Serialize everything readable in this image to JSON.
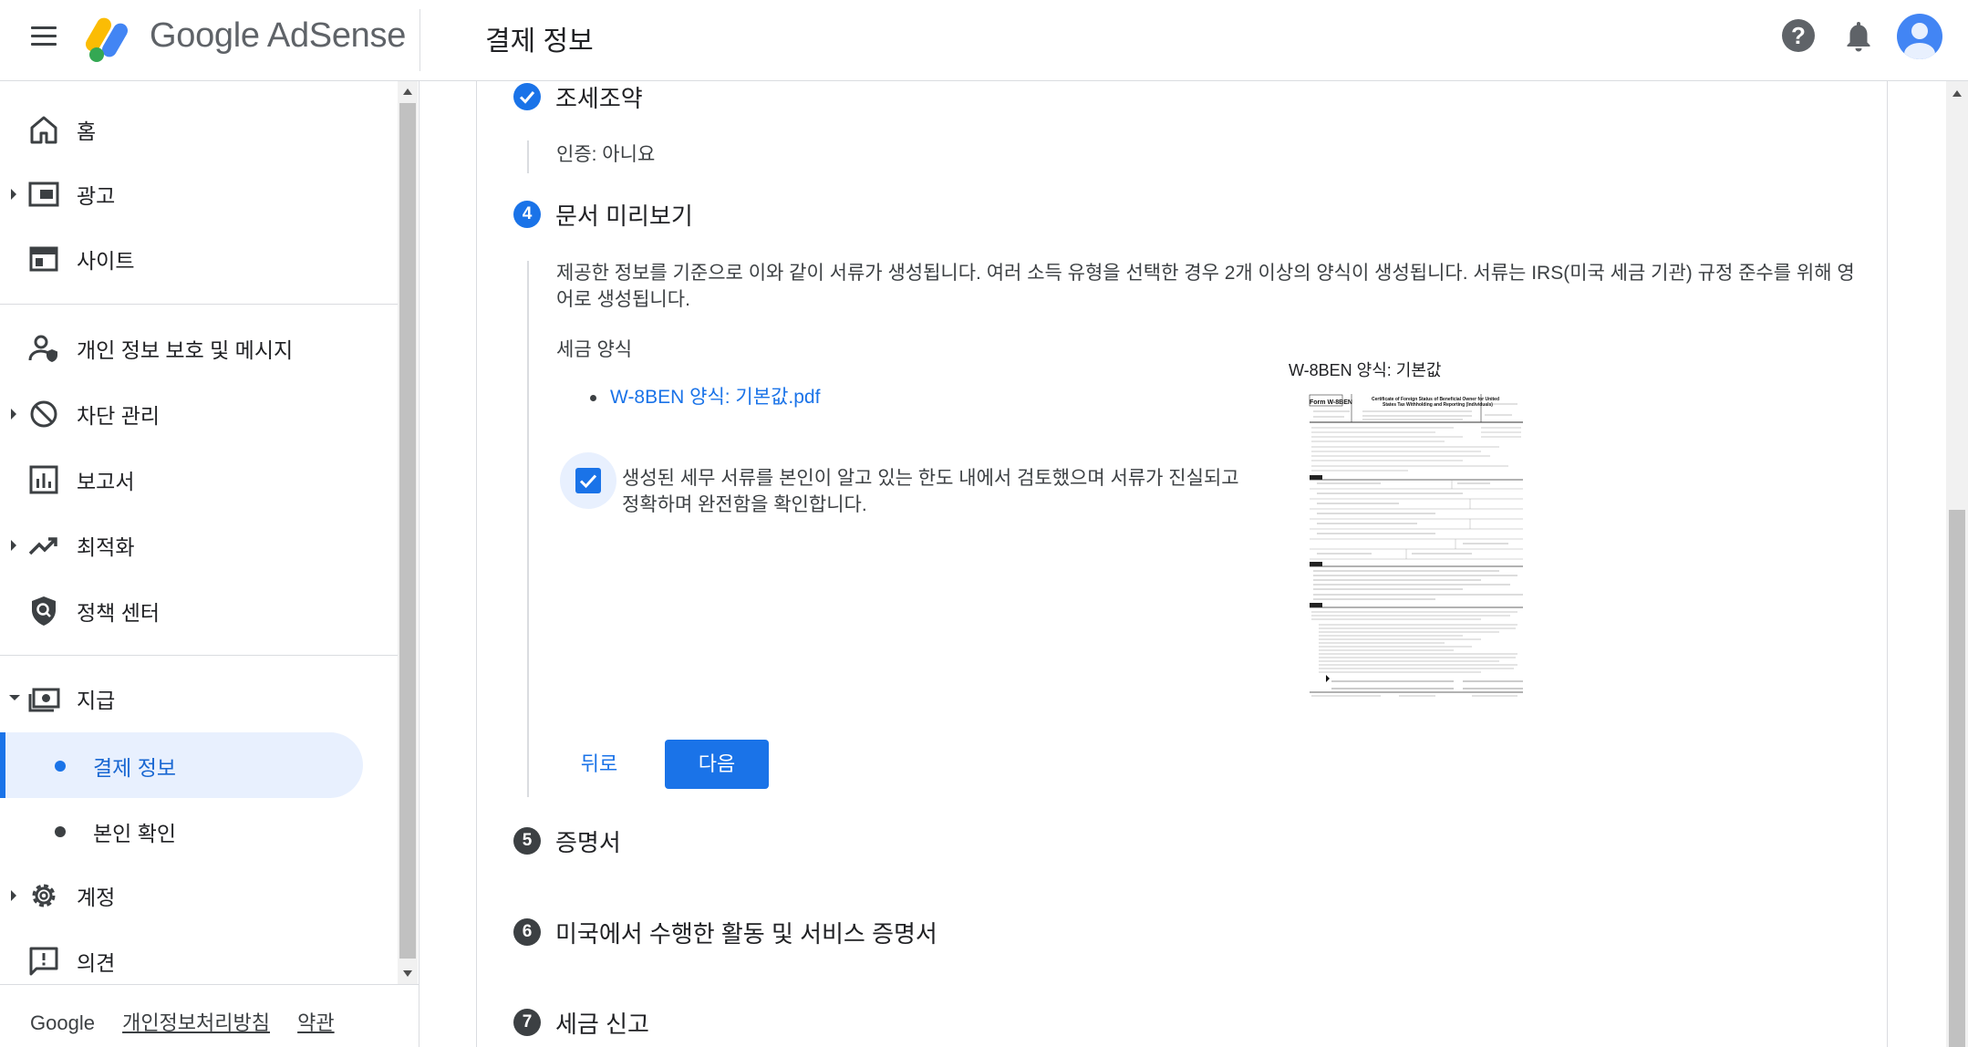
{
  "header": {
    "brand": "Google AdSense",
    "page_title": "결제 정보",
    "help": "?"
  },
  "sidebar": {
    "items": [
      {
        "label": "홈",
        "icon": "home-icon"
      },
      {
        "label": "광고",
        "icon": "ads-icon"
      },
      {
        "label": "사이트",
        "icon": "sites-icon"
      },
      {
        "label": "개인 정보 보호 및 메시지",
        "icon": "privacy-messaging-icon"
      },
      {
        "label": "차단 관리",
        "icon": "block-icon"
      },
      {
        "label": "보고서",
        "icon": "reports-icon"
      },
      {
        "label": "최적화",
        "icon": "optimization-icon"
      },
      {
        "label": "정책 센터",
        "icon": "policy-center-icon"
      },
      {
        "label": "지급",
        "icon": "payments-icon"
      },
      {
        "label": "계정",
        "icon": "gear-icon"
      },
      {
        "label": "의견",
        "icon": "feedback-icon"
      }
    ],
    "sub_items": [
      {
        "label": "결제 정보",
        "active": true
      },
      {
        "label": "본인 확인",
        "active": false
      }
    ]
  },
  "footer": {
    "google": "Google",
    "privacy": "개인정보처리방침",
    "terms": "약관"
  },
  "steps": {
    "tax_treaty": {
      "title": "조세조약",
      "detail": "인증: 아니요"
    },
    "preview": {
      "number": "4",
      "title": "문서 미리보기",
      "description": "제공한 정보를 기준으로 이와 같이 서류가 생성됩니다. 여러 소득 유형을 선택한 경우 2개 이상의 양식이 생성됩니다. 서류는 IRS(미국 세금 기관) 규정 준수를 위해 영어로 생성됩니다.",
      "forms_heading": "세금 양식",
      "form_link": "W-8BEN 양식: 기본값.pdf",
      "thumb_title": "W-8BEN 양식: 기본값",
      "confirm_text": "생성된 세무 서류를 본인이 알고 있는 한도 내에서 검토했으며 서류가 진실되고 정확하며 완전함을 확인합니다.",
      "confirm_checked": true,
      "back_label": "뒤로",
      "next_label": "다음"
    },
    "certificate": {
      "number": "5",
      "title": "증명서"
    },
    "us_activities": {
      "number": "6",
      "title": "미국에서 수행한 활동 및 서비스 증명서"
    },
    "tax_filing": {
      "number": "7",
      "title": "세금 신고"
    }
  },
  "colors": {
    "accent": "#1a73e8",
    "active_bg": "#e8f0fe",
    "text": "#202124"
  }
}
